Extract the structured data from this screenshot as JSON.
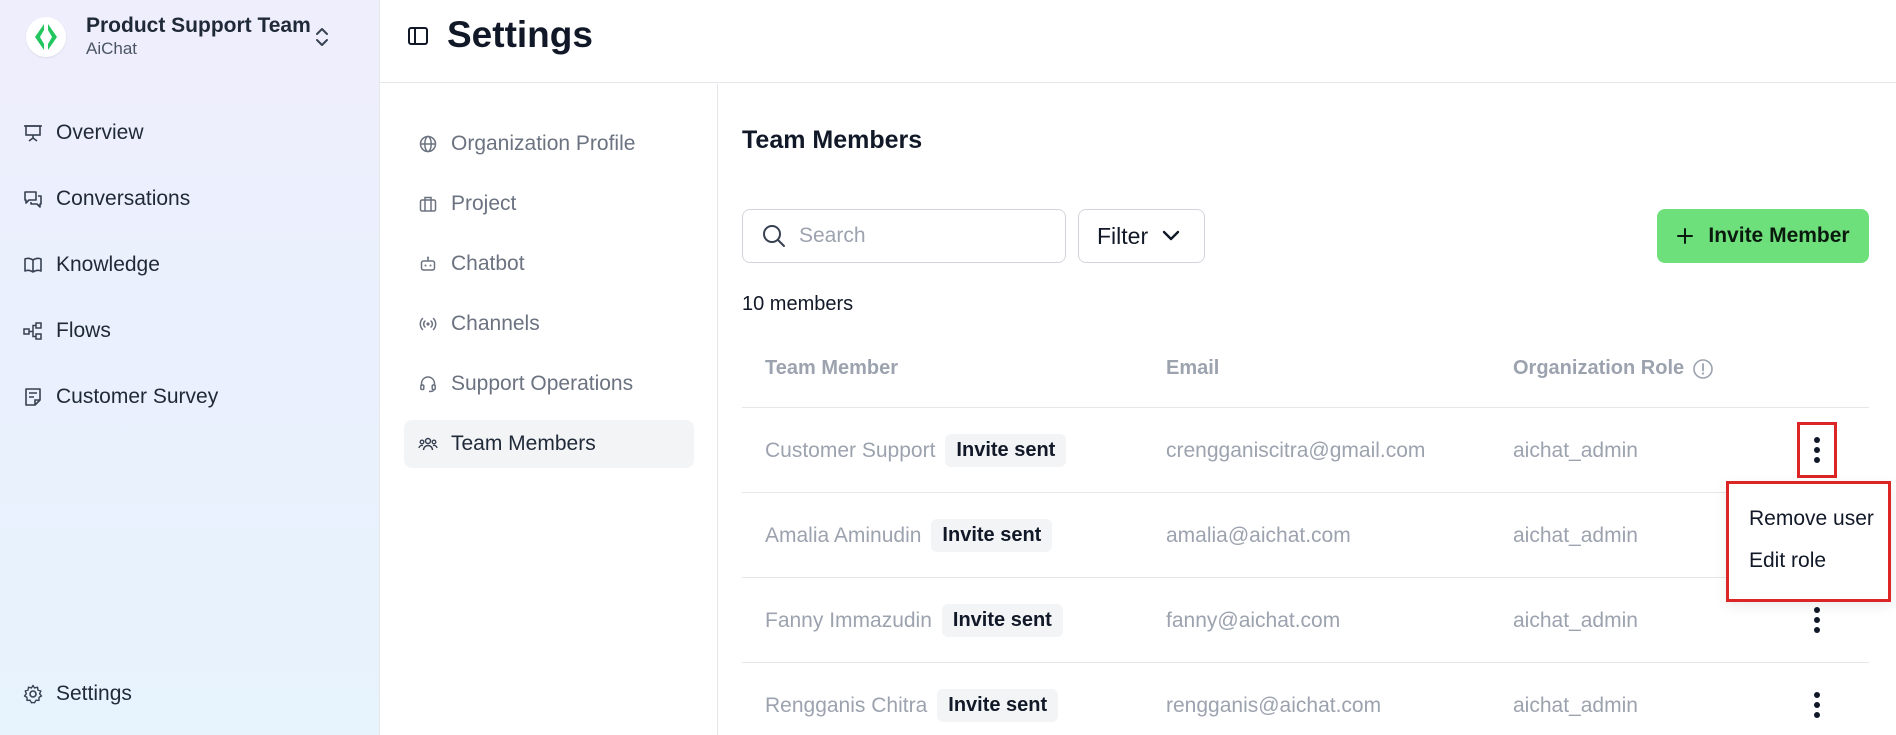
{
  "sidebar": {
    "team_name": "Product Support Team",
    "team_sub": "AiChat",
    "items": [
      {
        "label": "Overview",
        "icon": "presentation-icon"
      },
      {
        "label": "Conversations",
        "icon": "chat-bubbles-icon"
      },
      {
        "label": "Knowledge",
        "icon": "book-icon"
      },
      {
        "label": "Flows",
        "icon": "flow-icon"
      },
      {
        "label": "Customer Survey",
        "icon": "survey-icon"
      }
    ],
    "settings_label": "Settings"
  },
  "header": {
    "title": "Settings"
  },
  "settings_nav": {
    "items": [
      {
        "label": "Organization Profile",
        "icon": "globe-icon"
      },
      {
        "label": "Project",
        "icon": "briefcase-icon"
      },
      {
        "label": "Chatbot",
        "icon": "bot-icon"
      },
      {
        "label": "Channels",
        "icon": "broadcast-icon"
      },
      {
        "label": "Support Operations",
        "icon": "headset-icon"
      },
      {
        "label": "Team Members",
        "icon": "users-icon",
        "active": true
      }
    ]
  },
  "main": {
    "title": "Team Members",
    "search_placeholder": "Search",
    "filter_label": "Filter",
    "invite_label": "Invite Member",
    "member_count": "10 members",
    "columns": [
      "Team Member",
      "Email",
      "Organization Role"
    ],
    "rows": [
      {
        "name": "Customer Support",
        "badge": "Invite sent",
        "email": "crengganiscitra@gmail.com",
        "role": "aichat_admin"
      },
      {
        "name": "Amalia Aminudin",
        "badge": "Invite sent",
        "email": "amalia@aichat.com",
        "role": "aichat_admin"
      },
      {
        "name": "Fanny Immazudin",
        "badge": "Invite sent",
        "email": "fanny@aichat.com",
        "role": "aichat_admin"
      },
      {
        "name": "Rengganis Chitra",
        "badge": "Invite sent",
        "email": "rengganis@aichat.com",
        "role": "aichat_admin"
      }
    ]
  },
  "context_menu": {
    "items": [
      "Remove user",
      "Edit role"
    ]
  },
  "colors": {
    "accent_green": "#6ee07b",
    "highlight_red": "#dc2626"
  }
}
